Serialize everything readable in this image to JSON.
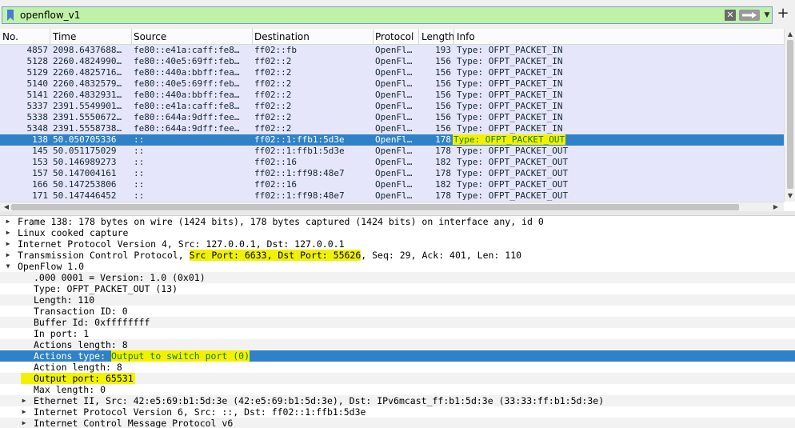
{
  "filter": {
    "value": "openflow_v1",
    "clear_icon": "clear-icon",
    "apply_icon": "arrow-right-icon"
  },
  "columns": {
    "no": "No.",
    "time": "Time",
    "source": "Source",
    "destination": "Destination",
    "protocol": "Protocol",
    "length": "Length",
    "info": "Info"
  },
  "packets": [
    {
      "no": "4857",
      "time": "2098.6437688…",
      "source": "fe80::e41a:caff:fe8…",
      "destination": "ff02::fb",
      "protocol": "OpenFl…",
      "length": "193",
      "info": "Type: OFPT_PACKET_IN"
    },
    {
      "no": "5128",
      "time": "2260.4824990…",
      "source": "fe80::40e5:69ff:feb…",
      "destination": "ff02::2",
      "protocol": "OpenFl…",
      "length": "156",
      "info": "Type: OFPT_PACKET_IN"
    },
    {
      "no": "5129",
      "time": "2260.4825716…",
      "source": "fe80::440a:bbff:fea…",
      "destination": "ff02::2",
      "protocol": "OpenFl…",
      "length": "156",
      "info": "Type: OFPT_PACKET_IN"
    },
    {
      "no": "5140",
      "time": "2260.4832579…",
      "source": "fe80::40e5:69ff:feb…",
      "destination": "ff02::2",
      "protocol": "OpenFl…",
      "length": "156",
      "info": "Type: OFPT_PACKET_IN"
    },
    {
      "no": "5141",
      "time": "2260.4832931…",
      "source": "fe80::440a:bbff:fea…",
      "destination": "ff02::2",
      "protocol": "OpenFl…",
      "length": "156",
      "info": "Type: OFPT_PACKET_IN"
    },
    {
      "no": "5337",
      "time": "2391.5549901…",
      "source": "fe80::e41a:caff:fe8…",
      "destination": "ff02::2",
      "protocol": "OpenFl…",
      "length": "156",
      "info": "Type: OFPT_PACKET_IN"
    },
    {
      "no": "5338",
      "time": "2391.5550672…",
      "source": "fe80::644a:9dff:fee…",
      "destination": "ff02::2",
      "protocol": "OpenFl…",
      "length": "156",
      "info": "Type: OFPT_PACKET_IN"
    },
    {
      "no": "5348",
      "time": "2391.5558738…",
      "source": "fe80::644a:9dff:fee…",
      "destination": "ff02::2",
      "protocol": "OpenFl…",
      "length": "156",
      "info": "Type: OFPT_PACKET_IN"
    },
    {
      "no": "138",
      "time": "50.050705336",
      "source": "::",
      "destination": "ff02::1:ffb1:5d3e",
      "protocol": "OpenFl…",
      "length": "178",
      "info": "Type: OFPT_PACKET_OUT"
    },
    {
      "no": "145",
      "time": "50.051175029",
      "source": "::",
      "destination": "ff02::1:ffb1:5d3e",
      "protocol": "OpenFl…",
      "length": "178",
      "info": "Type: OFPT_PACKET_OUT"
    },
    {
      "no": "153",
      "time": "50.146989273",
      "source": "::",
      "destination": "ff02::16",
      "protocol": "OpenFl…",
      "length": "182",
      "info": "Type: OFPT_PACKET_OUT"
    },
    {
      "no": "157",
      "time": "50.147004161",
      "source": "::",
      "destination": "ff02::1:ff98:48e7",
      "protocol": "OpenFl…",
      "length": "178",
      "info": "Type: OFPT_PACKET_OUT"
    },
    {
      "no": "166",
      "time": "50.147253806",
      "source": "::",
      "destination": "ff02::16",
      "protocol": "OpenFl…",
      "length": "182",
      "info": "Type: OFPT_PACKET_OUT"
    },
    {
      "no": "171",
      "time": "50.147446452",
      "source": "::",
      "destination": "ff02::1:ff98:48e7",
      "protocol": "OpenFl…",
      "length": "178",
      "info": "Type: OFPT_PACKET_OUT"
    }
  ],
  "details": {
    "frame": "Frame 138: 178 bytes on wire (1424 bits), 178 bytes captured (1424 bits) on interface any, id 0",
    "linux": "Linux cooked capture",
    "ipv4": "Internet Protocol Version 4, Src: 127.0.0.1, Dst: 127.0.0.1",
    "tcp_prefix": "Transmission Control Protocol, ",
    "tcp_ports": "Src Port: 6633, Dst Port: 55626",
    "tcp_suffix": ", Seq: 29, Ack: 401, Len: 110",
    "openflow": "OpenFlow 1.0",
    "version": ".000 0001 = Version: 1.0 (0x01)",
    "type": "Type: OFPT_PACKET_OUT (13)",
    "length": "Length: 110",
    "xid": "Transaction ID: 0",
    "buffer": "Buffer Id: 0xffffffff",
    "in_port": "In port: 1",
    "actions_length": "Actions length: 8",
    "actions_type_label": "Actions type: ",
    "actions_type_value": "Output to switch port (0)",
    "action_length": "Action length: 8",
    "output_port": "Output port: 65531",
    "max_length": "Max length: 0",
    "ethernet": "Ethernet II, Src: 42:e5:69:b1:5d:3e (42:e5:69:b1:5d:3e), Dst: IPv6mcast_ff:b1:5d:3e (33:33:ff:b1:5d:3e)",
    "ipv6": "Internet Protocol Version 6, Src: ::, Dst: ff02::1:ffb1:5d3e",
    "icmpv6": "Internet Control Message Protocol v6"
  },
  "colors": {
    "filter_ok": "#bff2a8",
    "row_bg": "#e6e6fa",
    "selected": "#2f82c7",
    "highlight": "#f2f200"
  }
}
